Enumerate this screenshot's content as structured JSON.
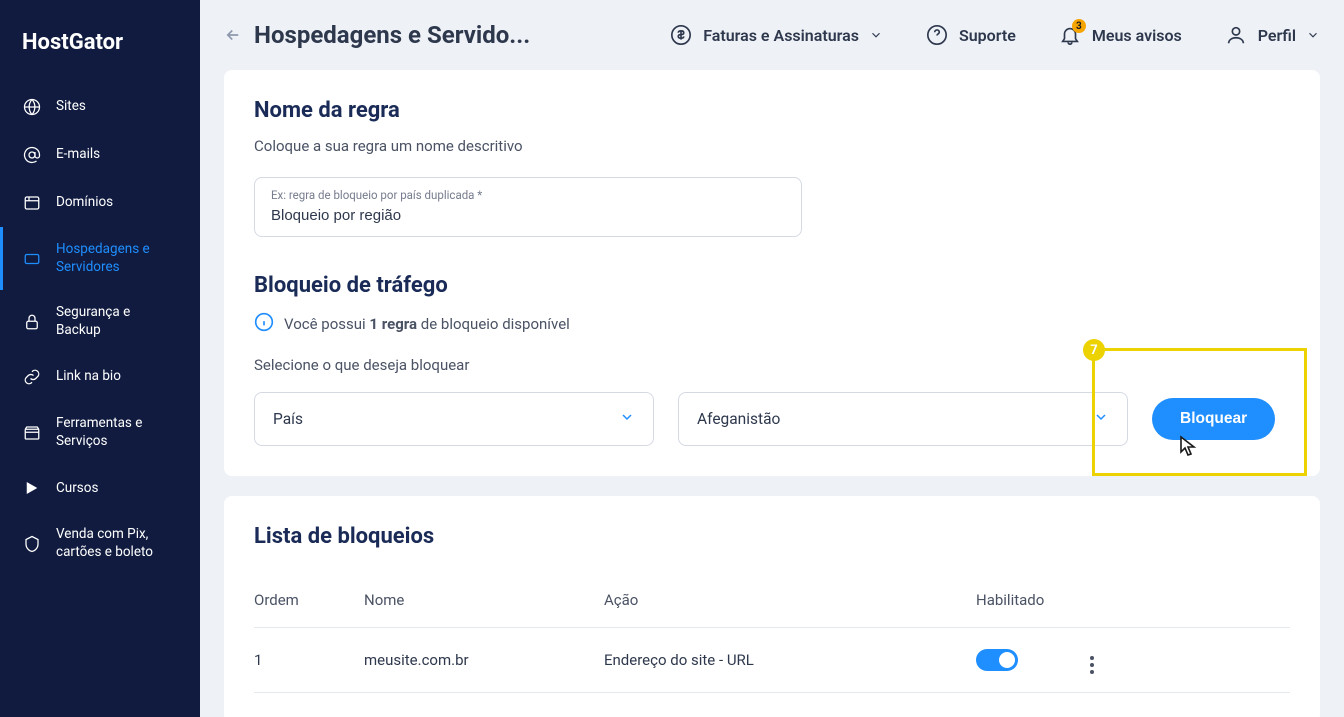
{
  "brand": "HostGator",
  "sidebar": {
    "items": [
      {
        "label": "Sites"
      },
      {
        "label": "E-mails"
      },
      {
        "label": "Domínios"
      },
      {
        "label": "Hospedagens e Servidores"
      },
      {
        "label": "Segurança e Backup"
      },
      {
        "label": "Link na bio"
      },
      {
        "label": "Ferramentas e Serviços"
      },
      {
        "label": "Cursos"
      },
      {
        "label": "Venda com Pix, cartões e boleto"
      }
    ]
  },
  "header": {
    "page_title": "Hospedagens e Servido...",
    "invoices": "Faturas e Assinaturas",
    "support": "Suporte",
    "notices": "Meus avisos",
    "badge_count": "3",
    "profile": "Perfil"
  },
  "rule_section": {
    "title": "Nome da regra",
    "subtitle": "Coloque a sua regra um nome descritivo",
    "field_label": "Ex: regra de bloqueio por país duplicada *",
    "field_value": "Bloqueio por região"
  },
  "traffic_section": {
    "title": "Bloqueio de tráfego",
    "info_prefix": "Você possui ",
    "info_bold": "1 regra",
    "info_suffix": " de bloqueio disponível",
    "select_prompt": "Selecione o que deseja bloquear",
    "type_value": "País",
    "value_value": "Afeganistão",
    "button": "Bloquear"
  },
  "annotation": {
    "number": "7"
  },
  "list_section": {
    "title": "Lista de bloqueios",
    "columns": {
      "ordem": "Ordem",
      "nome": "Nome",
      "acao": "Ação",
      "habilitado": "Habilitado"
    },
    "rows": [
      {
        "ordem": "1",
        "nome": "meusite.com.br",
        "acao": "Endereço do site - URL",
        "enabled": true
      }
    ]
  }
}
